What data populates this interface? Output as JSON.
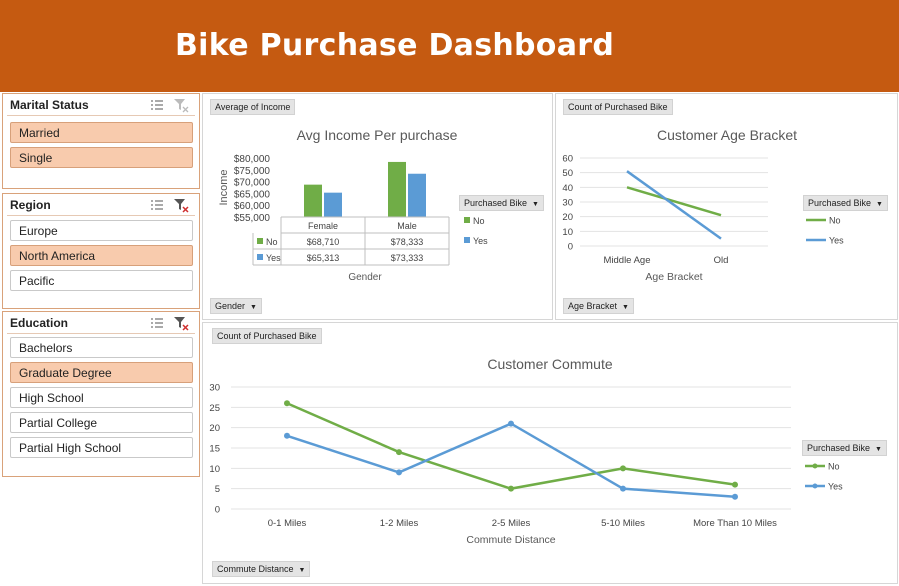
{
  "header": {
    "title": "Bike Purchase Dashboard"
  },
  "colors": {
    "banner": "#c55a11",
    "no": "#70ad47",
    "yes": "#5b9bd5",
    "selected": "#f8cbad"
  },
  "slicers": {
    "marital": {
      "title": "Marital Status",
      "items": [
        {
          "label": "Married",
          "selected": true
        },
        {
          "label": "Single",
          "selected": true
        }
      ]
    },
    "region": {
      "title": "Region",
      "items": [
        {
          "label": "Europe",
          "selected": false
        },
        {
          "label": "North America",
          "selected": true
        },
        {
          "label": "Pacific",
          "selected": false
        }
      ]
    },
    "education": {
      "title": "Education",
      "items": [
        {
          "label": "Bachelors",
          "selected": false
        },
        {
          "label": "Graduate Degree",
          "selected": true
        },
        {
          "label": "High School",
          "selected": false
        },
        {
          "label": "Partial College",
          "selected": false
        },
        {
          "label": "Partial High School",
          "selected": false
        }
      ]
    }
  },
  "income_panel": {
    "value_button": "Average of Income",
    "axis_button": "Gender",
    "legend_button": "Purchased Bike"
  },
  "age_panel": {
    "value_button": "Count of Purchased Bike",
    "axis_button": "Age Bracket",
    "legend_button": "Purchased Bike"
  },
  "commute_panel": {
    "value_button": "Count of Purchased Bike",
    "axis_button": "Commute Distance",
    "legend_button": "Purchased Bike"
  },
  "chart_data": [
    {
      "type": "bar",
      "title": "Avg Income Per purchase",
      "xlabel": "Gender",
      "ylabel": "Income",
      "categories": [
        "Female",
        "Male"
      ],
      "yticks": [
        "$80,000",
        "$75,000",
        "$70,000",
        "$65,000",
        "$60,000",
        "$55,000"
      ],
      "ylim": [
        55000,
        80000
      ],
      "series": [
        {
          "name": "No",
          "values": [
            68710,
            78333
          ],
          "labels": [
            "$68,710",
            "$78,333"
          ]
        },
        {
          "name": "Yes",
          "values": [
            65313,
            73333
          ],
          "labels": [
            "$65,313",
            "$73,333"
          ]
        }
      ],
      "legend": "right",
      "data_table": true
    },
    {
      "type": "line",
      "title": "Customer Age Bracket",
      "xlabel": "Age Bracket",
      "ylabel": "",
      "categories": [
        "Middle Age",
        "Old"
      ],
      "yticks": [
        "60",
        "50",
        "40",
        "30",
        "20",
        "10",
        "0"
      ],
      "ylim": [
        0,
        60
      ],
      "series": [
        {
          "name": "No",
          "values": [
            40,
            21
          ]
        },
        {
          "name": "Yes",
          "values": [
            51,
            5
          ]
        }
      ],
      "legend": "right"
    },
    {
      "type": "line",
      "title": "Customer Commute",
      "xlabel": "Commute Distance",
      "ylabel": "",
      "categories": [
        "0-1 Miles",
        "1-2 Miles",
        "2-5 Miles",
        "5-10 Miles",
        "More Than 10 Miles"
      ],
      "yticks": [
        "30",
        "25",
        "20",
        "15",
        "10",
        "5",
        "0"
      ],
      "ylim": [
        0,
        30
      ],
      "series": [
        {
          "name": "No",
          "values": [
            26,
            14,
            5,
            10,
            6
          ]
        },
        {
          "name": "Yes",
          "values": [
            18,
            9,
            21,
            5,
            3
          ]
        }
      ],
      "legend": "right",
      "markers": true
    }
  ]
}
